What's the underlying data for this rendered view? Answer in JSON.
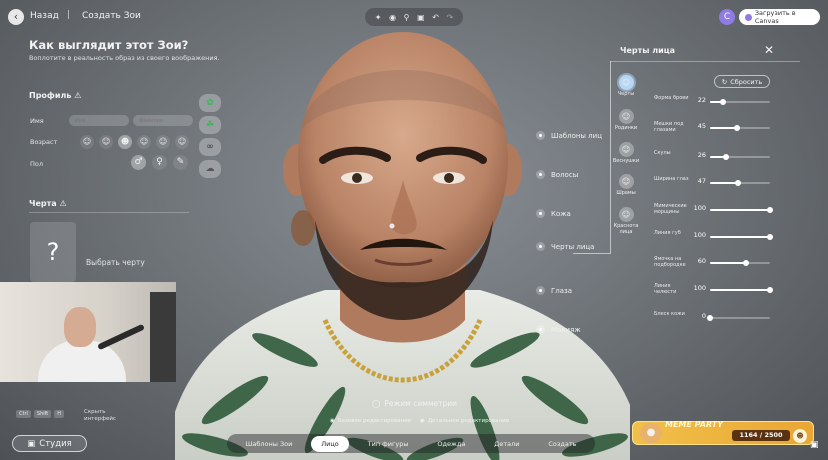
{
  "header": {
    "back_label": "Назад",
    "separator": "|",
    "breadcrumb": "Создать Зои",
    "canva_avatar_letter": "C",
    "canva_button": "Загрузить в Canvas"
  },
  "intro": {
    "title": "Как выглядит этот Зои?",
    "subtitle": "Воплотите в реальность образ из своего воображения."
  },
  "profile": {
    "title": "Профиль",
    "name_label": "Имя",
    "name_placeholder": "Имя",
    "surname_placeholder": "Фамилия",
    "age_label": "Возраст",
    "sex_label": "Пол"
  },
  "trait": {
    "title": "Черта",
    "card_symbol": "?",
    "pick_label": "Выбрать черту"
  },
  "hint": {
    "keys": [
      "Ctrl",
      "Shift",
      "H"
    ],
    "text": "Скрыть интерфейс"
  },
  "studio_label": "Студия",
  "categories": [
    "Шаблоны лиц",
    "Волосы",
    "Кожа",
    "Черты лица",
    "Глаза",
    "Макияж"
  ],
  "right_panel": {
    "title": "Черты лица",
    "reset_label": "Сбросить",
    "features": [
      {
        "label": "Черты",
        "icon": "face-icon",
        "selected": true
      },
      {
        "label": "Родинки",
        "icon": "mole-icon",
        "selected": false
      },
      {
        "label": "Веснушки",
        "icon": "freckles-icon",
        "selected": false
      },
      {
        "label": "Шрамы",
        "icon": "scar-icon",
        "selected": false
      },
      {
        "label": "Краснота лица",
        "icon": "redness-icon",
        "selected": false
      }
    ],
    "sliders": [
      {
        "label": "Форма брови",
        "value": 22
      },
      {
        "label": "Мешки под глазами",
        "value": 45
      },
      {
        "label": "Скулы",
        "value": 26
      },
      {
        "label": "Ширина глаз",
        "value": 47
      },
      {
        "label": "Мимические морщины",
        "value": 100
      },
      {
        "label": "Линия губ",
        "value": 100
      },
      {
        "label": "Ямочка на подбородке",
        "value": 60
      },
      {
        "label": "Линия челюсти",
        "value": 100
      },
      {
        "label": "Блеск кожи",
        "value": 0
      }
    ]
  },
  "bottom": {
    "symmetry_label": "Режим симметрии",
    "base_edit": "Базовое редактирование",
    "detail_edit": "Детальное редактирование",
    "tabs": [
      "Шаблоны Зои",
      "Лицо",
      "Тип фигуры",
      "Одежда",
      "Детали",
      "Создать"
    ],
    "active_tab": "Лицо"
  },
  "meme_party": {
    "title": "MEME PARTY",
    "counter": "1164 / 2500"
  }
}
